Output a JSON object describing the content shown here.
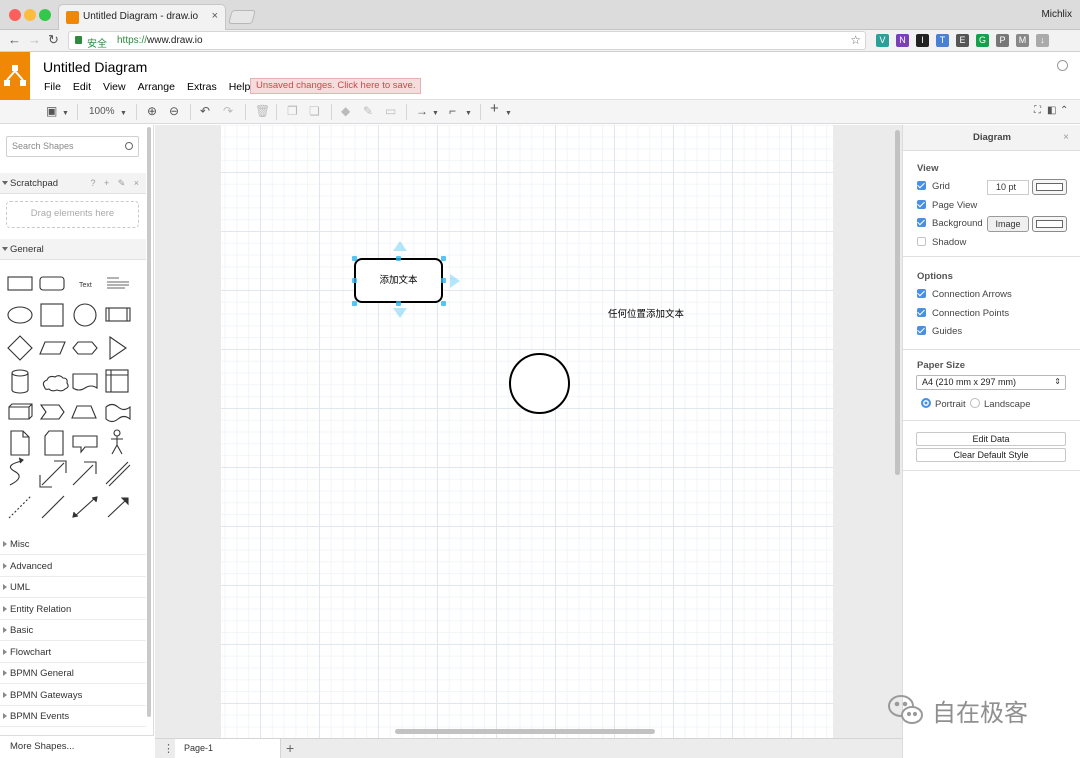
{
  "browser": {
    "tab_title": "Untitled Diagram - draw.io",
    "tab_close": "×",
    "profile_name": "Michlix",
    "secure_label": "安全",
    "url_scheme": "https://",
    "url_host": "www.draw.io",
    "extensions": [
      {
        "icon": "vue-devtools-icon",
        "glyph": "V",
        "color": "#2aa198"
      },
      {
        "icon": "onenote-icon",
        "glyph": "N",
        "color": "#7a3fb6"
      },
      {
        "icon": "instapaper-icon",
        "glyph": "I",
        "color": "#222222"
      },
      {
        "icon": "translate-icon",
        "glyph": "T",
        "color": "#4a7fd6"
      },
      {
        "icon": "evernote-icon",
        "glyph": "E",
        "color": "#555555"
      },
      {
        "icon": "grammarly-icon",
        "glyph": "G",
        "color": "#15a04a"
      },
      {
        "icon": "pocket-icon",
        "glyph": "P",
        "color": "#777777"
      },
      {
        "icon": "mail-icon",
        "glyph": "M",
        "color": "#888888"
      },
      {
        "icon": "download-icon",
        "glyph": "↓",
        "color": "#aaaaaa"
      }
    ]
  },
  "app": {
    "title": "Untitled Diagram",
    "menu": [
      "File",
      "Edit",
      "View",
      "Arrange",
      "Extras",
      "Help"
    ],
    "unsaved_notice": "Unsaved changes. Click here to save.",
    "brand_color": "#f08705"
  },
  "toolbar": {
    "zoom": "100%"
  },
  "left_panel": {
    "search_placeholder": "Search Shapes",
    "scratchpad_label": "Scratchpad",
    "scratchpad_tools": "? + ✎ ×",
    "scratchpad_drop": "Drag elements here",
    "general_label": "General",
    "text_shape_label": "Text",
    "sections": [
      "Misc",
      "Advanced",
      "UML",
      "Entity Relation",
      "Basic",
      "Flowchart",
      "BPMN General",
      "BPMN Gateways",
      "BPMN Events"
    ],
    "more_shapes": "More Shapes..."
  },
  "canvas": {
    "rect_text": "添加文本",
    "free_text": "任何位置添加文本"
  },
  "pages": {
    "menu_glyph": "⋮",
    "current": "Page-1",
    "add_glyph": "+"
  },
  "right_panel": {
    "header": "Diagram",
    "close": "×",
    "view": {
      "title": "View",
      "grid": "Grid",
      "grid_size": "10 pt",
      "page_view": "Page View",
      "background": "Background",
      "image_button": "Image",
      "shadow": "Shadow"
    },
    "options": {
      "title": "Options",
      "connection_arrows": "Connection Arrows",
      "connection_points": "Connection Points",
      "guides": "Guides"
    },
    "paper": {
      "title": "Paper Size",
      "selected": "A4 (210 mm x 297 mm)",
      "portrait": "Portrait",
      "landscape": "Landscape"
    },
    "edit_data": "Edit Data",
    "clear_style": "Clear Default Style",
    "accent_color": "#4a90e2"
  },
  "watermark": {
    "text": "自在极客"
  }
}
